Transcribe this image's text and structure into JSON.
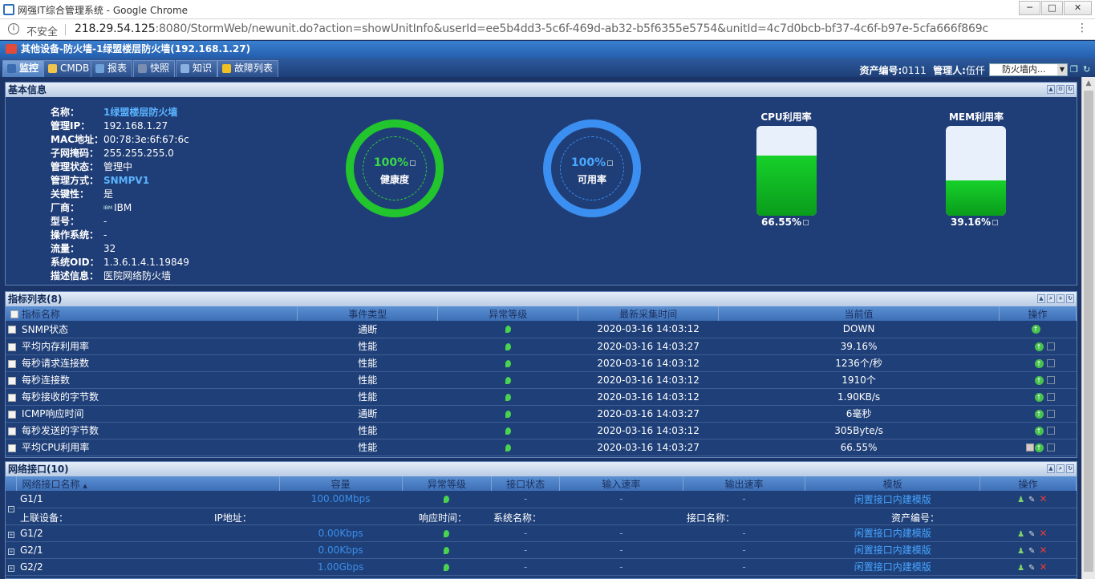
{
  "window": {
    "title": "网强IT综合管理系统 - Google Chrome",
    "min": "─",
    "max": "□",
    "close": "✕"
  },
  "address": {
    "info_glyph": "i",
    "security": "不安全",
    "host": "218.29.54.125",
    "rest": ":8080/StormWeb/newunit.do?action=showUnitInfo&userId=ee5b4dd3-5c6f-469d-ab32-b5f6355e5754&unitId=4c7d0bcb-bf37-4c6f-b97e-5cfa666f869c",
    "menu_glyph": "⋮"
  },
  "header": {
    "title": "其他设备-防火墙-1绿盟楼层防火墙(192.168.1.27)"
  },
  "tabs": [
    {
      "label": "监控",
      "color": "#3b6bb0"
    },
    {
      "label": "CMDB",
      "color": "#f2c54a"
    },
    {
      "label": "报表",
      "color": "#6fa0d8"
    },
    {
      "label": "快照",
      "color": "#7a8fb0"
    },
    {
      "label": "知识",
      "color": "#8ab0e0"
    },
    {
      "label": "故障列表",
      "color": "#f0c020"
    }
  ],
  "meta": {
    "asset_label": "资产编号:",
    "asset_value": "0111",
    "manager_label": "管理人:",
    "manager_value": "伍仟",
    "select_value": "防火墙内..."
  },
  "basic": {
    "title": "基本信息",
    "fields": [
      {
        "k": "名称：",
        "v": "1绿盟楼层防火墙",
        "link": true
      },
      {
        "k": "管理IP：",
        "v": "192.168.1.27"
      },
      {
        "k": "MAC地址：",
        "v": "00:78:3e:6f:67:6c"
      },
      {
        "k": "子网掩码：",
        "v": "255.255.255.0"
      },
      {
        "k": "管理状态：",
        "v": "管理中"
      },
      {
        "k": "管理方式：",
        "v": "SNMPV1",
        "link": true
      },
      {
        "k": "关键性：",
        "v": "是"
      },
      {
        "k": "厂商：",
        "v": "IBM",
        "logo": "IBM"
      },
      {
        "k": "型号：",
        "v": "-"
      },
      {
        "k": "操作系统：",
        "v": "-"
      },
      {
        "k": "流量：",
        "v": "32"
      },
      {
        "k": "系统OID：",
        "v": "1.3.6.1.4.1.19849"
      },
      {
        "k": "描述信息：",
        "v": "医院网络防火墙"
      }
    ],
    "health": {
      "pct": "100%",
      "label": "健康度",
      "value": 100,
      "color": "#22c52e"
    },
    "avail": {
      "pct": "100%",
      "label": "可用率",
      "value": 100,
      "color": "#3a8ff0"
    },
    "cpu": {
      "title": "CPU利用率",
      "value": "66.55%",
      "fraction": 0.6655
    },
    "mem": {
      "title": "MEM利用率",
      "value": "39.16%",
      "fraction": 0.3916
    }
  },
  "indicators": {
    "title": "指标列表(8)",
    "columns": [
      "指标名称",
      "事件类型",
      "异常等级",
      "最新采集时间",
      "当前值",
      "操作"
    ],
    "rows": [
      {
        "name": "SNMP状态",
        "type": "通断",
        "time": "2020-03-16 14:03:12",
        "value": "DOWN",
        "chart": false,
        "warn": false
      },
      {
        "name": "平均内存利用率",
        "type": "性能",
        "time": "2020-03-16 14:03:27",
        "value": "39.16%",
        "chart": true,
        "warn": false
      },
      {
        "name": "每秒请求连接数",
        "type": "性能",
        "time": "2020-03-16 14:03:12",
        "value": "1236个/秒",
        "chart": true,
        "warn": false
      },
      {
        "name": "每秒连接数",
        "type": "性能",
        "time": "2020-03-16 14:03:12",
        "value": "1910个",
        "chart": true,
        "warn": false
      },
      {
        "name": "每秒接收的字节数",
        "type": "性能",
        "time": "2020-03-16 14:03:12",
        "value": "1.90KB/s",
        "chart": true,
        "warn": false
      },
      {
        "name": "ICMP响应时间",
        "type": "通断",
        "time": "2020-03-16 14:03:27",
        "value": "6毫秒",
        "chart": true,
        "warn": false
      },
      {
        "name": "每秒发送的字节数",
        "type": "性能",
        "time": "2020-03-16 14:03:12",
        "value": "305Byte/s",
        "chart": true,
        "warn": false
      },
      {
        "name": "平均CPU利用率",
        "type": "性能",
        "time": "2020-03-16 14:03:27",
        "value": "66.55%",
        "chart": true,
        "warn": true
      }
    ]
  },
  "netif": {
    "title": "网络接口(10)",
    "columns": [
      "网络接口名称",
      "容量",
      "异常等级",
      "接口状态",
      "输入速率",
      "输出速率",
      "模板",
      "操作"
    ],
    "sort_glyph": "▲",
    "detail": {
      "upstream": "上联设备：",
      "ip": "IP地址：",
      "resp": "响应时间：",
      "sysname": "系统名称：",
      "ifname": "接口名称：",
      "asset": "资产编号："
    },
    "rows": [
      {
        "name": "G1/1",
        "capacity": "100.00Mbps",
        "status": "-",
        "in": "-",
        "out": "-",
        "template": "闲置接口内建模版",
        "expanded": true
      },
      {
        "name": "G1/2",
        "capacity": "0.00Kbps",
        "status": "-",
        "in": "-",
        "out": "-",
        "template": "闲置接口内建模版",
        "expanded": false
      },
      {
        "name": "G2/1",
        "capacity": "0.00Kbps",
        "status": "-",
        "in": "-",
        "out": "-",
        "template": "闲置接口内建模版",
        "expanded": false
      },
      {
        "name": "G2/2",
        "capacity": "1.00Gbps",
        "status": "-",
        "in": "-",
        "out": "-",
        "template": "闲置接口内建模版",
        "expanded": false
      }
    ]
  }
}
